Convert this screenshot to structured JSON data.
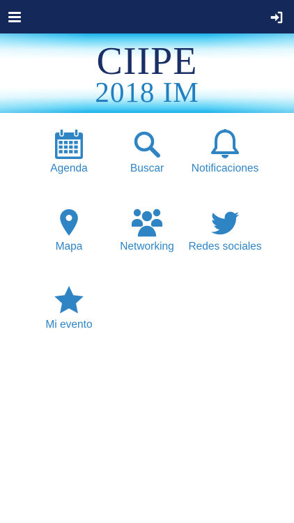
{
  "header": {
    "menu_icon": "hamburger-menu-icon",
    "login_icon": "sign-in-icon"
  },
  "banner": {
    "logo_line1": "CIIPE",
    "logo_line2": "2018 IM"
  },
  "menu": {
    "accent_color": "#2f84c4",
    "items": [
      {
        "label": "Agenda",
        "icon": "calendar-icon"
      },
      {
        "label": "Buscar",
        "icon": "search-icon"
      },
      {
        "label": "Notificaciones",
        "icon": "bell-icon"
      },
      {
        "label": "Mapa",
        "icon": "map-marker-icon"
      },
      {
        "label": "Networking",
        "icon": "users-icon"
      },
      {
        "label": "Redes sociales",
        "icon": "twitter-icon"
      },
      {
        "label": "Mi evento",
        "icon": "star-icon"
      }
    ]
  },
  "colors": {
    "topbar": "#14295a",
    "logo_dark": "#1a2f66",
    "logo_light": "#1f7fc1",
    "banner_edge": "#1bb0e8"
  }
}
